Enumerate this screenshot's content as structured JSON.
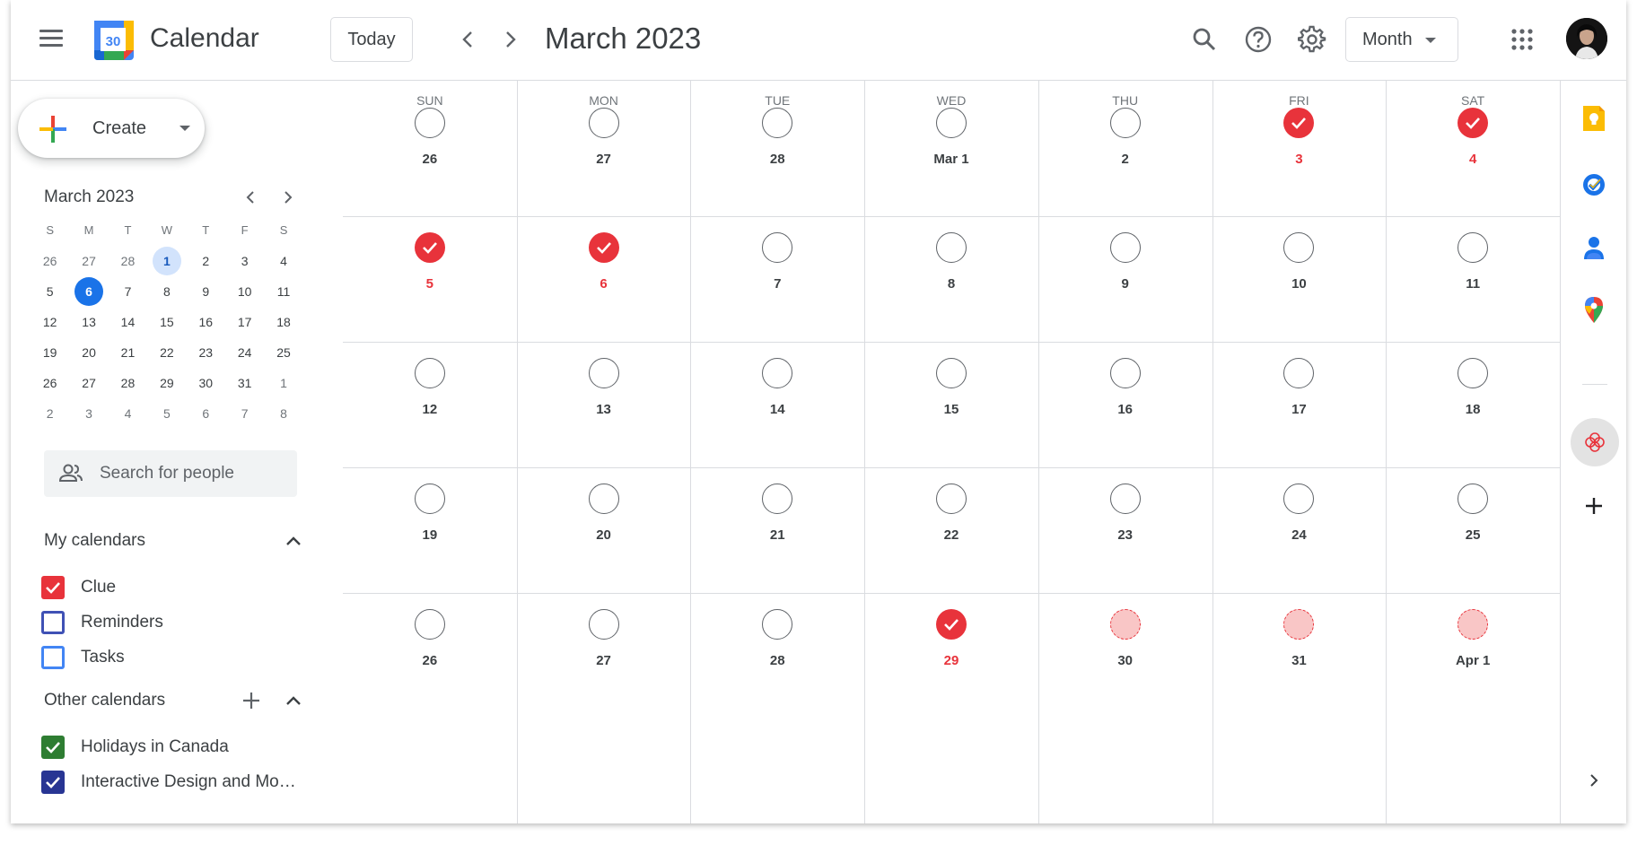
{
  "app": {
    "title": "Calendar",
    "logo_day": "30"
  },
  "header": {
    "today_label": "Today",
    "date_title": "March 2023",
    "view_label": "Month"
  },
  "sidebar": {
    "create_label": "Create",
    "mini": {
      "title": "March 2023",
      "weekdays": [
        "S",
        "M",
        "T",
        "W",
        "T",
        "F",
        "S"
      ],
      "weeks": [
        [
          "26",
          "27",
          "28",
          "1",
          "2",
          "3",
          "4"
        ],
        [
          "5",
          "6",
          "7",
          "8",
          "9",
          "10",
          "11"
        ],
        [
          "12",
          "13",
          "14",
          "15",
          "16",
          "17",
          "18"
        ],
        [
          "19",
          "20",
          "21",
          "22",
          "23",
          "24",
          "25"
        ],
        [
          "26",
          "27",
          "28",
          "29",
          "30",
          "31",
          "1"
        ],
        [
          "2",
          "3",
          "4",
          "5",
          "6",
          "7",
          "8"
        ]
      ]
    },
    "people_search_placeholder": "Search for people",
    "my_calendars_title": "My calendars",
    "my_calendars": [
      {
        "name": "Clue",
        "checked": true,
        "color": "#e8333b"
      },
      {
        "name": "Reminders",
        "checked": false,
        "color": "#3f51b5"
      },
      {
        "name": "Tasks",
        "checked": false,
        "color": "#4285f4"
      }
    ],
    "other_calendars_title": "Other calendars",
    "other_calendars": [
      {
        "name": "Holidays in Canada",
        "checked": true,
        "color": "#33b679"
      },
      {
        "name": "Interactive Design and Mo…",
        "checked": true,
        "color": "#3f51b5"
      }
    ]
  },
  "grid": {
    "weekdays": [
      "SUN",
      "MON",
      "TUE",
      "WED",
      "THU",
      "FRI",
      "SAT"
    ],
    "weeks": [
      [
        {
          "label": "26",
          "state": "empty"
        },
        {
          "label": "27",
          "state": "empty"
        },
        {
          "label": "28",
          "state": "empty"
        },
        {
          "label": "Mar 1",
          "state": "empty"
        },
        {
          "label": "2",
          "state": "empty"
        },
        {
          "label": "3",
          "state": "done"
        },
        {
          "label": "4",
          "state": "done"
        }
      ],
      [
        {
          "label": "5",
          "state": "done"
        },
        {
          "label": "6",
          "state": "done"
        },
        {
          "label": "7",
          "state": "empty"
        },
        {
          "label": "8",
          "state": "empty"
        },
        {
          "label": "9",
          "state": "empty"
        },
        {
          "label": "10",
          "state": "empty"
        },
        {
          "label": "11",
          "state": "empty"
        }
      ],
      [
        {
          "label": "12",
          "state": "empty"
        },
        {
          "label": "13",
          "state": "empty"
        },
        {
          "label": "14",
          "state": "empty"
        },
        {
          "label": "15",
          "state": "empty"
        },
        {
          "label": "16",
          "state": "empty"
        },
        {
          "label": "17",
          "state": "empty"
        },
        {
          "label": "18",
          "state": "empty"
        }
      ],
      [
        {
          "label": "19",
          "state": "empty"
        },
        {
          "label": "20",
          "state": "empty"
        },
        {
          "label": "21",
          "state": "empty"
        },
        {
          "label": "22",
          "state": "empty"
        },
        {
          "label": "23",
          "state": "empty"
        },
        {
          "label": "24",
          "state": "empty"
        },
        {
          "label": "25",
          "state": "empty"
        }
      ],
      [
        {
          "label": "26",
          "state": "empty"
        },
        {
          "label": "27",
          "state": "empty"
        },
        {
          "label": "28",
          "state": "empty"
        },
        {
          "label": "29",
          "state": "done"
        },
        {
          "label": "30",
          "state": "predicted"
        },
        {
          "label": "31",
          "state": "predicted"
        },
        {
          "label": "Apr 1",
          "state": "predicted"
        }
      ]
    ]
  },
  "colors": {
    "accent": "#1a73e8",
    "clue_red": "#e8333b"
  },
  "rail": {
    "items": [
      "keep-icon",
      "tasks-icon",
      "contacts-icon",
      "maps-icon",
      "clue-addon-icon",
      "add-addon-icon",
      "expand-icon"
    ]
  }
}
